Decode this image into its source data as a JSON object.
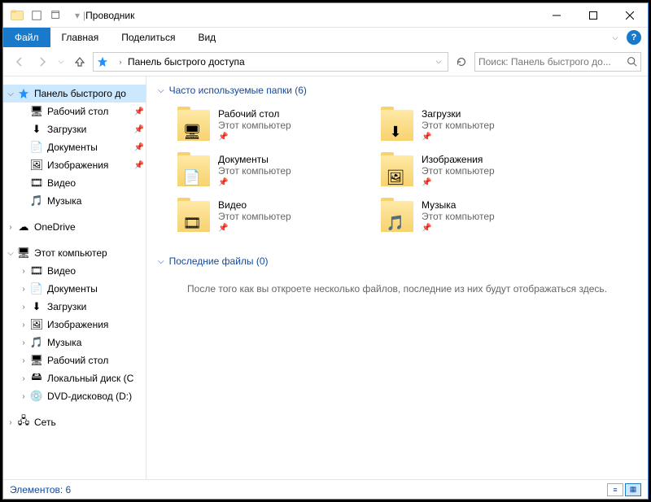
{
  "title": "Проводник",
  "ribbon": {
    "file": "Файл",
    "tabs": [
      "Главная",
      "Поделиться",
      "Вид"
    ]
  },
  "address": {
    "location": "Панель быстрого доступа"
  },
  "search": {
    "placeholder": "Поиск: Панель быстрого до..."
  },
  "sidebar": {
    "quick_access": {
      "label": "Панель быстрого до",
      "items": [
        {
          "label": "Рабочий стол",
          "icon": "desktop",
          "pinned": true
        },
        {
          "label": "Загрузки",
          "icon": "downloads",
          "pinned": true
        },
        {
          "label": "Документы",
          "icon": "documents",
          "pinned": true
        },
        {
          "label": "Изображения",
          "icon": "pictures",
          "pinned": true
        },
        {
          "label": "Видео",
          "icon": "videos",
          "pinned": false
        },
        {
          "label": "Музыка",
          "icon": "music",
          "pinned": false
        }
      ]
    },
    "onedrive": {
      "label": "OneDrive"
    },
    "this_pc": {
      "label": "Этот компьютер",
      "items": [
        {
          "label": "Видео",
          "icon": "videos"
        },
        {
          "label": "Документы",
          "icon": "documents"
        },
        {
          "label": "Загрузки",
          "icon": "downloads"
        },
        {
          "label": "Изображения",
          "icon": "pictures"
        },
        {
          "label": "Музыка",
          "icon": "music"
        },
        {
          "label": "Рабочий стол",
          "icon": "desktop"
        },
        {
          "label": "Локальный диск (C",
          "icon": "disk"
        },
        {
          "label": "DVD-дисковод (D:)",
          "icon": "dvd"
        }
      ]
    },
    "network": {
      "label": "Сеть"
    }
  },
  "content": {
    "frequent": {
      "title": "Часто используемые папки (6)",
      "items": [
        {
          "name": "Рабочий стол",
          "sub": "Этот компьютер",
          "overlay": "🖥"
        },
        {
          "name": "Загрузки",
          "sub": "Этот компьютер",
          "overlay": "⬇"
        },
        {
          "name": "Документы",
          "sub": "Этот компьютер",
          "overlay": "📄"
        },
        {
          "name": "Изображения",
          "sub": "Этот компьютер",
          "overlay": "🖼"
        },
        {
          "name": "Видео",
          "sub": "Этот компьютер",
          "overlay": "🎞"
        },
        {
          "name": "Музыка",
          "sub": "Этот компьютер",
          "overlay": "🎵"
        }
      ]
    },
    "recent": {
      "title": "Последние файлы (0)",
      "empty_msg": "После того как вы откроете несколько файлов, последние из них будут отображаться здесь."
    }
  },
  "statusbar": {
    "text": "Элементов: 6"
  }
}
